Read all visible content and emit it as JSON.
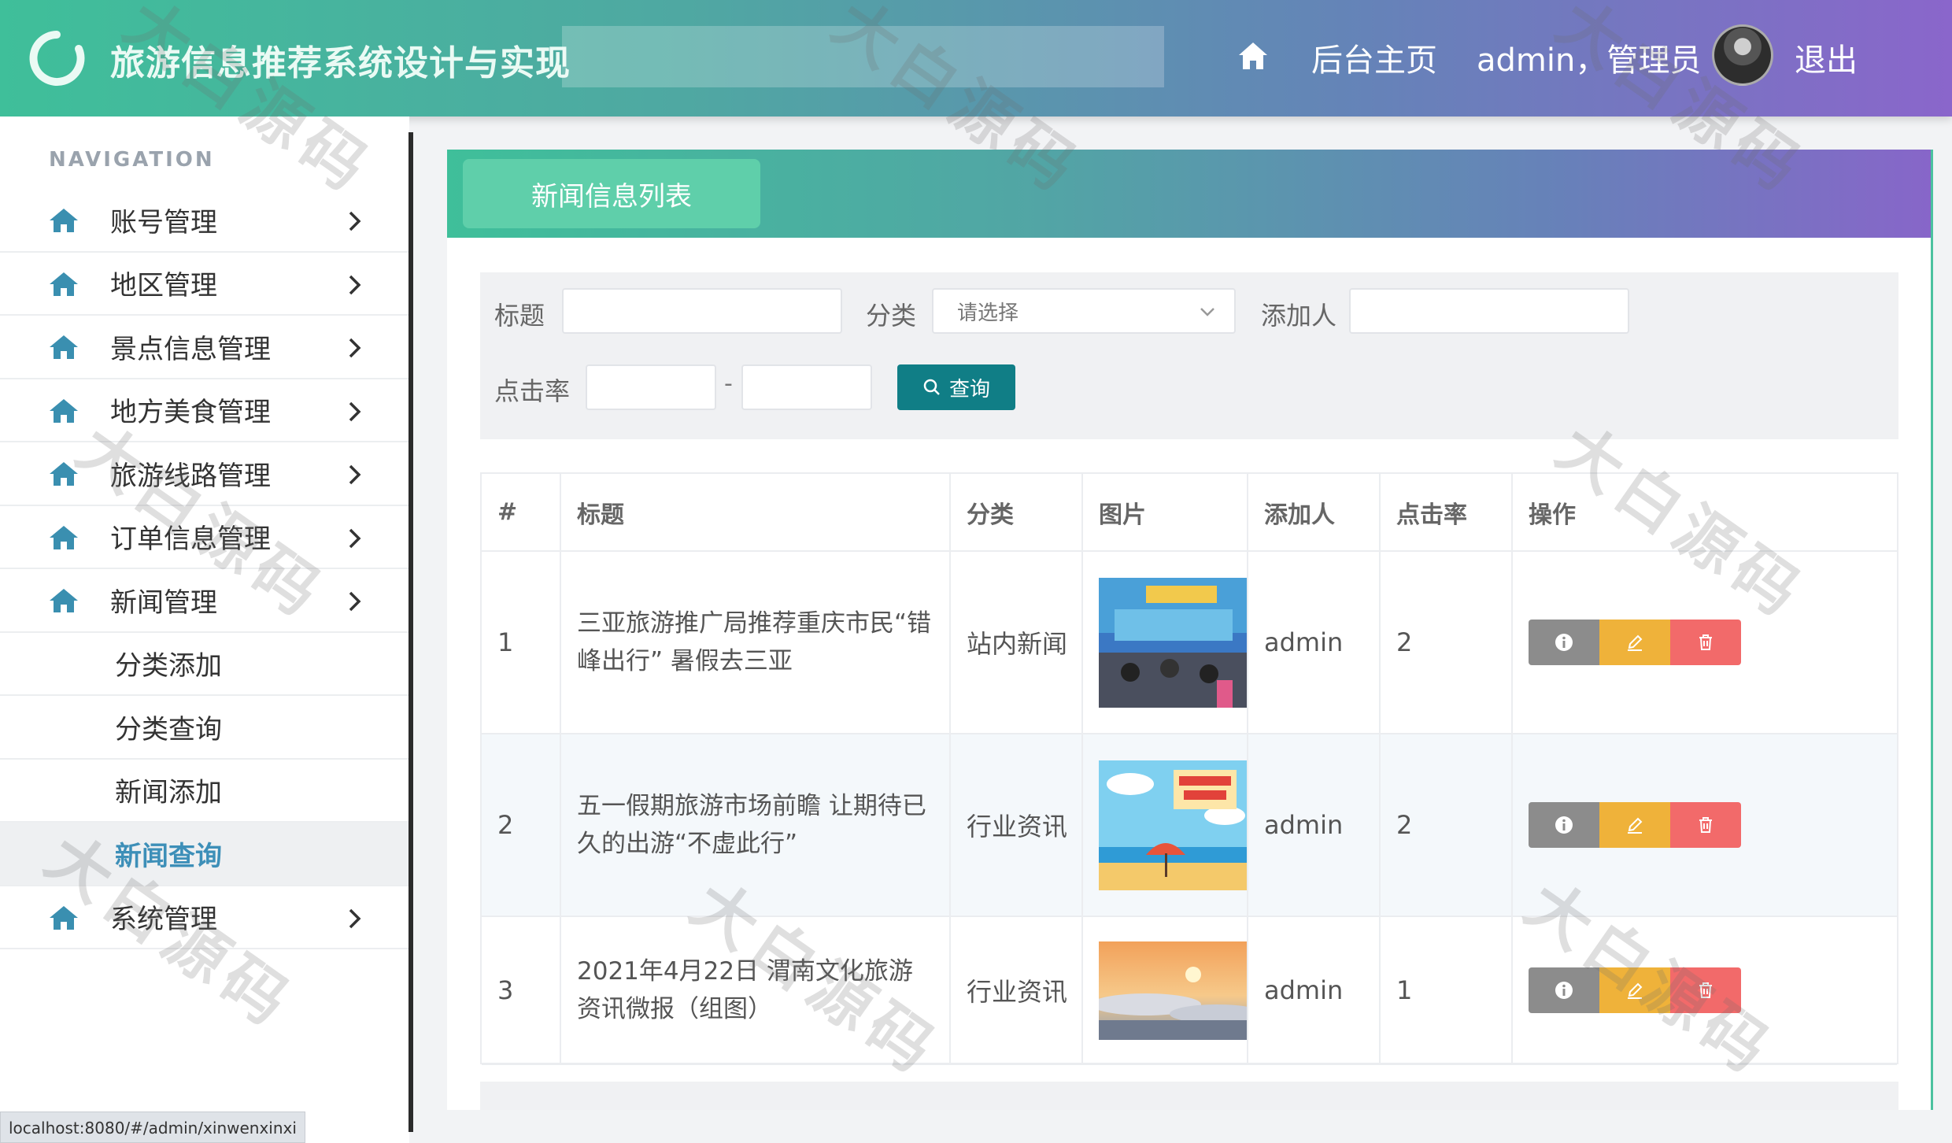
{
  "header": {
    "app_title": "旅游信息推荐系统设计与实现",
    "home_label": "后台主页",
    "user_label": "admin，管理员",
    "logout_label": "退出"
  },
  "sidebar": {
    "heading": "NAVIGATION",
    "items": [
      {
        "label": "账号管理"
      },
      {
        "label": "地区管理"
      },
      {
        "label": "景点信息管理"
      },
      {
        "label": "地方美食管理"
      },
      {
        "label": "旅游线路管理"
      },
      {
        "label": "订单信息管理"
      },
      {
        "label": "新闻管理"
      },
      {
        "label": "分类添加"
      },
      {
        "label": "分类查询"
      },
      {
        "label": "新闻添加"
      },
      {
        "label": "新闻查询"
      },
      {
        "label": "系统管理"
      }
    ]
  },
  "panel": {
    "tab_label": "新闻信息列表"
  },
  "filter": {
    "title_label": "标题",
    "title_value": "",
    "category_label": "分类",
    "category_placeholder": "请选择",
    "adder_label": "添加人",
    "adder_value": "",
    "clicks_label": "点击率",
    "clicks_min": "",
    "range_sep": "-",
    "clicks_max": "",
    "search_label": "查询"
  },
  "table": {
    "columns": [
      "#",
      "标题",
      "分类",
      "图片",
      "添加人",
      "点击率",
      "操作"
    ],
    "rows": [
      {
        "index": "1",
        "title": "三亚旅游推广局推荐重庆市民“错峰出行” 暑假去三亚",
        "category": "站内新闻",
        "image": "event-photo",
        "adder": "admin",
        "clicks": "2"
      },
      {
        "index": "2",
        "title": "五一假期旅游市场前瞻 让期待已久的出游“不虚此行”",
        "category": "行业资讯",
        "image": "beach-cartoon",
        "adder": "admin",
        "clicks": "2"
      },
      {
        "index": "3",
        "title": "2021年4月22日 渭南文化旅游资讯微报（组图）",
        "category": "行业资讯",
        "image": "sunrise-clouds",
        "adder": "admin",
        "clicks": "1"
      }
    ]
  },
  "watermark": "大白源码",
  "status_url": "localhost:8080/#/admin/xinwenxinxi",
  "colors": {
    "accent_green": "#3fbf9a",
    "accent_purple": "#8a66cb",
    "search_button": "#107e86",
    "op_info": "#8c8c8c",
    "op_edit": "#efb23a",
    "op_delete": "#f26a6a",
    "active_menu_text": "#3d8fb8"
  },
  "icons": {
    "logo": "refresh-ring-icon",
    "home": "home-icon",
    "chevron": "chevron-right-icon",
    "info": "info-icon",
    "edit": "edit-icon",
    "delete": "trash-icon",
    "search": "search-icon"
  }
}
